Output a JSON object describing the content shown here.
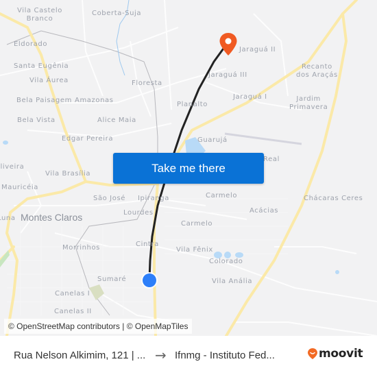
{
  "map": {
    "places": [
      {
        "label": "Vila Castelo\nBranco",
        "kind": "multi"
      },
      {
        "label": "Coberta-Suja"
      },
      {
        "label": "Eldorado"
      },
      {
        "label": "Santa Eugênia"
      },
      {
        "label": "Vila Áurea"
      },
      {
        "label": "Bela Paisagem"
      },
      {
        "label": "Amazonas"
      },
      {
        "label": "Floresta"
      },
      {
        "label": "Bela Vista"
      },
      {
        "label": "Alice Maia"
      },
      {
        "label": "Edgar Pereira"
      },
      {
        "label": "Planalto"
      },
      {
        "label": "Jaraguá II"
      },
      {
        "label": "Jaraguá III"
      },
      {
        "label": "Jaraguá I"
      },
      {
        "label": "Recanto\ndos Araçás",
        "kind": "multi"
      },
      {
        "label": "Jardim\nPrimavera",
        "kind": "multi"
      },
      {
        "label": "Guarujá"
      },
      {
        "label": "Real"
      },
      {
        "label": "Oliveira"
      },
      {
        "label": "Vila Brasília"
      },
      {
        "label": "Mauricéia"
      },
      {
        "label": "São José"
      },
      {
        "label": "Ipiranga"
      },
      {
        "label": "Carmelo"
      },
      {
        "label": "Acácias"
      },
      {
        "label": "Chácaras Ceres"
      },
      {
        "label": "Montes Claros",
        "kind": "city"
      },
      {
        "label": "Lourdes"
      },
      {
        "label": "Carmelo"
      },
      {
        "label": "Morrinhos"
      },
      {
        "label": "Cintra"
      },
      {
        "label": "Vila Fênix"
      },
      {
        "label": "Colorado"
      },
      {
        "label": "Sumaré"
      },
      {
        "label": "Vila Anália"
      },
      {
        "label": "Canelas I"
      },
      {
        "label": "Canelas II"
      },
      {
        "label": "Luna"
      }
    ],
    "attribution": "© OpenStreetMap contributors | © OpenMapTiles",
    "destination_pin_color": "#f05a22",
    "origin_dot_color": "#2d7ff9",
    "route_color": "#222222"
  },
  "cta": {
    "label": "Take me there",
    "color": "#0a72d6"
  },
  "footer": {
    "origin": "Rua Nelson Alkimim, 121 | ...",
    "arrow": "→",
    "destination": "Ifnmg - Instituto Fed...",
    "brand": "moovit",
    "brand_color": "#f26a24"
  }
}
